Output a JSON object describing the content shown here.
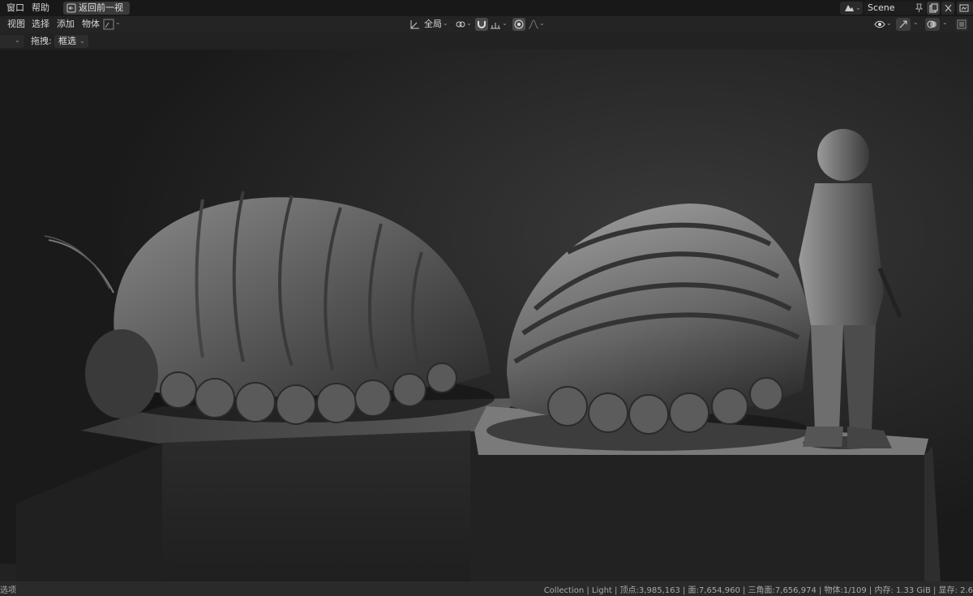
{
  "topbar": {
    "menus": [
      "窗口",
      "帮助"
    ],
    "back_button": "返回前一视图",
    "scene_name": "Scene"
  },
  "toolbar": {
    "menus": [
      "视图",
      "选择",
      "添加",
      "物体"
    ],
    "transform_orientation": "全局"
  },
  "header": {
    "drag_label": "拖拽:",
    "drag_value": "框选"
  },
  "viewport": {
    "description_icons": [
      "isopod-model-left",
      "isopod-model-right",
      "soldier-figure",
      "pedestal-left",
      "pedestal-right"
    ]
  },
  "statusbar": {
    "left_text": "选项",
    "stats": "Collection | Light | 顶点:3,985,163 | 面:7,654,960 | 三角面:7,656,974 | 物体:1/109 | 内存: 1.33 GiB | 显存: 2.6"
  },
  "colors": {
    "bg_dark": "#181818",
    "viewport": "#1c1c1c",
    "active_blue": "#4772b3"
  }
}
